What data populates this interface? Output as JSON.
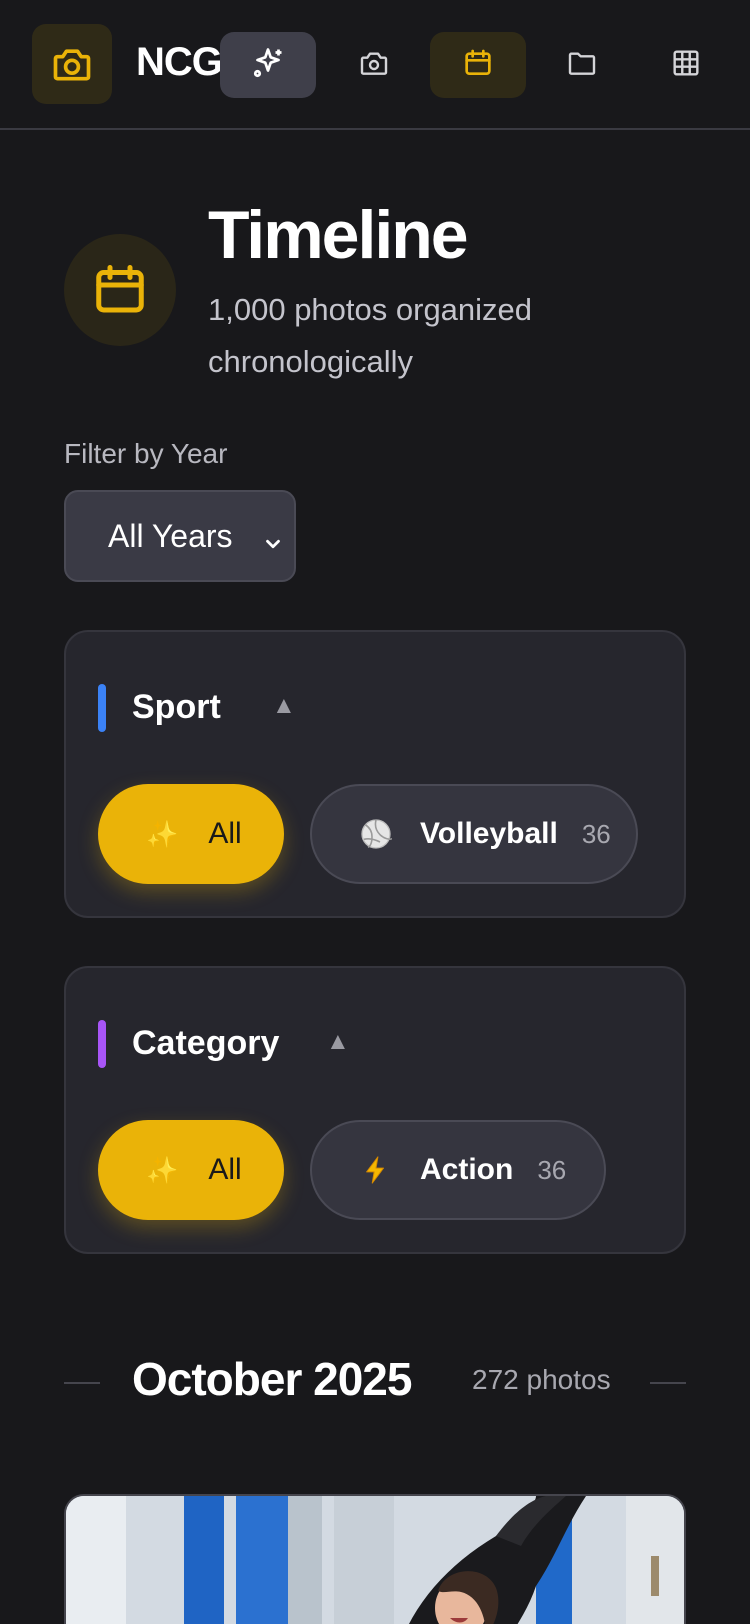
{
  "header": {
    "brand": "NCG",
    "nav": [
      {
        "name": "sparkle-icon",
        "active": false
      },
      {
        "name": "camera-icon",
        "active": false
      },
      {
        "name": "calendar-icon",
        "active": true
      },
      {
        "name": "folder-icon",
        "active": false
      },
      {
        "name": "grid-icon",
        "active": false
      }
    ],
    "accent": "#eab308"
  },
  "hero": {
    "title": "Timeline",
    "subtitle": "1,000 photos organized chronologically",
    "icon": "calendar-icon"
  },
  "filter": {
    "label": "Filter by Year",
    "selected": "All Years"
  },
  "sport_panel": {
    "title": "Sport",
    "accent": "#3b82f6",
    "all_label": "All",
    "all_icon": "✨",
    "option": {
      "label": "Volleyball",
      "icon": "🏐",
      "count": "36"
    }
  },
  "category_panel": {
    "title": "Category",
    "accent": "#a855f7",
    "all_label": "All",
    "all_icon": "✨",
    "option": {
      "label": "Action",
      "icon": "⚡",
      "count": "36"
    }
  },
  "month": {
    "title": "October 2025",
    "count": "272 photos"
  }
}
